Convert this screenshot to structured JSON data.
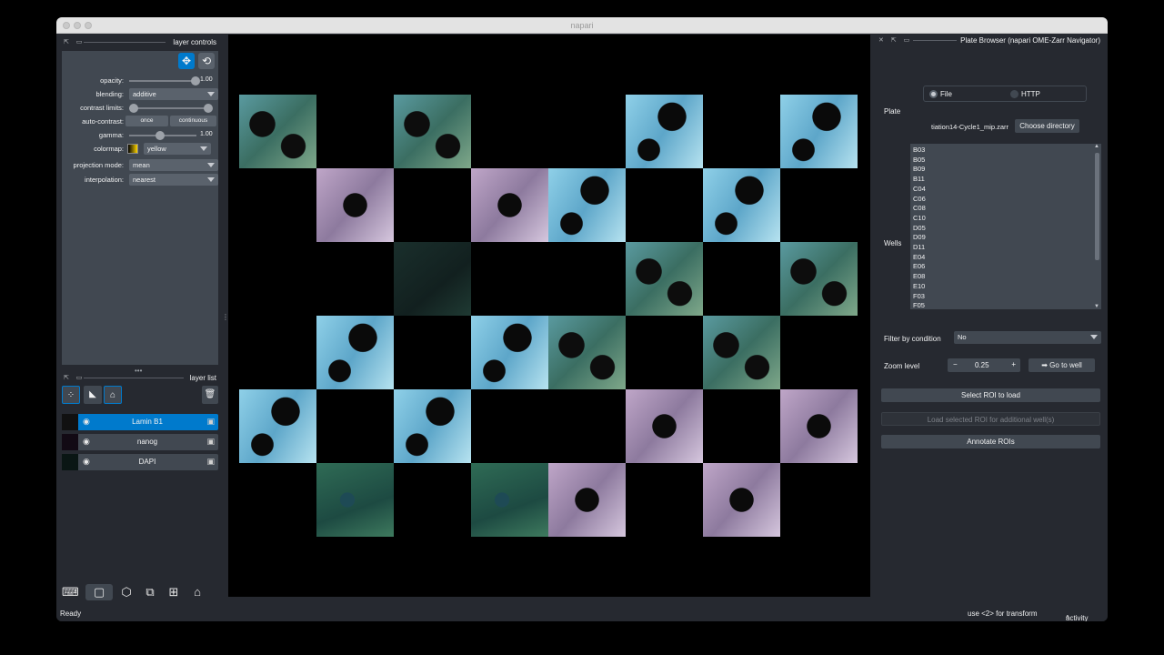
{
  "window": {
    "title": "napari"
  },
  "layer_controls": {
    "header": "layer controls",
    "opacity": {
      "label": "opacity:",
      "value": "1.00",
      "level": 1.0
    },
    "blending": {
      "label": "blending:",
      "value": "additive"
    },
    "contrast_limits": {
      "label": "contrast limits:",
      "low": 0.0,
      "high": 1.0
    },
    "auto_contrast": {
      "label": "auto-contrast:",
      "once": "once",
      "continuous": "continuous"
    },
    "gamma": {
      "label": "gamma:",
      "value": "1.00",
      "level": 0.5
    },
    "colormap": {
      "label": "colormap:",
      "value": "yellow",
      "swatch": "#ffd500"
    },
    "projection_mode": {
      "label": "projection mode:",
      "value": "mean"
    },
    "interpolation": {
      "label": "interpolation:",
      "value": "nearest"
    }
  },
  "layer_list": {
    "header": "layer list",
    "layers": [
      {
        "name": "Lamin B1",
        "selected": true
      },
      {
        "name": "nanog",
        "selected": false
      },
      {
        "name": "DAPI",
        "selected": false
      }
    ]
  },
  "plate_browser": {
    "header": "Plate Browser (napari OME-Zarr Navigator)",
    "plate_label": "Plate",
    "source_file": "File",
    "source_http": "HTTP",
    "plate_path": "tiation14-Cycle1_mip.zarr",
    "choose_dir": "Choose directory",
    "wells_label": "Wells",
    "wells": [
      "B03",
      "B05",
      "B09",
      "B11",
      "C04",
      "C06",
      "C08",
      "C10",
      "D05",
      "D09",
      "D11",
      "E04",
      "E06",
      "E08",
      "E10",
      "F03",
      "F05"
    ],
    "filter_label": "Filter by condition",
    "filter_value": "No",
    "zoom_label": "Zoom level",
    "zoom_value": "0.25",
    "go_to_well": "➡ Go to well",
    "select_roi": "Select ROI to load",
    "load_selected_roi": "Load selected ROI for additional well(s)",
    "annotate_rois": "Annotate ROIs"
  },
  "status": {
    "left": "Ready",
    "hint": "use <2> for transform",
    "activity": "activity"
  },
  "colors": {
    "accent": "#007acc",
    "panel": "#262930",
    "control": "#414851"
  }
}
